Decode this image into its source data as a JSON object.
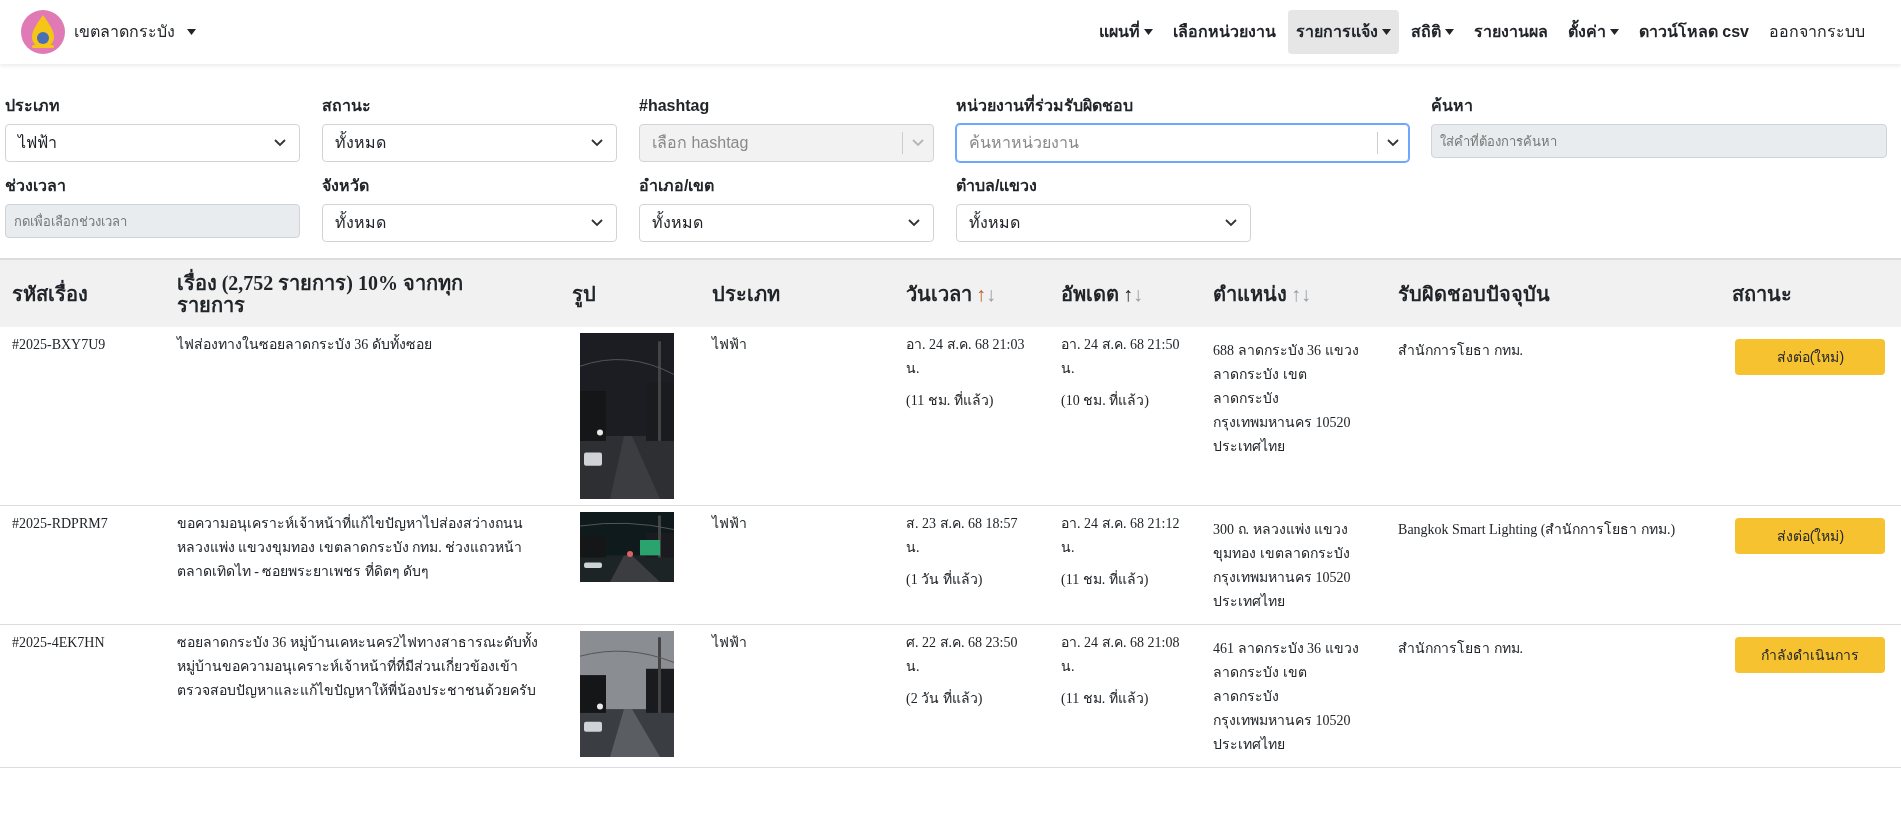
{
  "navbar": {
    "brand": "เขตลาดกระบัง",
    "items": [
      {
        "label": "แผนที่",
        "kind": "dropdown",
        "selected": false
      },
      {
        "label": "เลือกหน่วยงาน",
        "kind": "link",
        "selected": false
      },
      {
        "label": "รายการแจ้ง",
        "kind": "dropdown",
        "selected": true
      },
      {
        "label": "สถิติ",
        "kind": "dropdown",
        "selected": false
      },
      {
        "label": "รายงานผล",
        "kind": "link",
        "selected": false
      },
      {
        "label": "ตั้งค่า",
        "kind": "dropdown",
        "selected": false
      },
      {
        "label": "ดาวน์โหลด csv",
        "kind": "link",
        "selected": false
      },
      {
        "label": "ออกจากระบบ",
        "kind": "plain",
        "selected": false
      }
    ]
  },
  "filters": [
    [
      {
        "label": "ประเภท",
        "kind": "select",
        "value": "ไฟฟ้า",
        "focused": false
      },
      {
        "label": "สถานะ",
        "kind": "select",
        "value": "ทั้งหมด",
        "focused": false
      },
      {
        "label": "#hashtag",
        "kind": "combobox",
        "placeholder": "เลือก hashtag",
        "focused": false
      },
      {
        "label": "หน่วยงานที่ร่วมรับผิดชอบ",
        "kind": "combobox",
        "placeholder": "ค้นหาหน่วยงาน",
        "focused": true
      },
      {
        "label": "ค้นหา",
        "kind": "input",
        "placeholder": "ใส่คำที่ต้องการค้นหา",
        "focused": false
      }
    ],
    [
      {
        "label": "ช่วงเวลา",
        "kind": "input",
        "placeholder": "กดเพื่อเลือกช่วงเวลา",
        "focused": false
      },
      {
        "label": "จังหวัด",
        "kind": "select",
        "value": "ทั้งหมด",
        "focused": false
      },
      {
        "label": "อำเภอ/เขต",
        "kind": "select",
        "value": "ทั้งหมด",
        "focused": false
      },
      {
        "label": "ตำบล/แขวง",
        "kind": "select",
        "value": "ทั้งหมด",
        "focused": false
      }
    ]
  ],
  "table": {
    "columns": [
      {
        "label": "รหัสเรื่อง"
      },
      {
        "label": "เรื่อง (2,752 รายการ) 10% จากทุกรายการ"
      },
      {
        "label": "รูป"
      },
      {
        "label": "ประเภท"
      },
      {
        "label": "วันเวลา",
        "kind": "sorted",
        "up": "↑",
        "down": "↓"
      },
      {
        "label": "อัพเดต",
        "kind": "ascending",
        "up": "↑",
        "down": "↓"
      },
      {
        "label": "ตำแหน่ง",
        "kind": "sortable",
        "up": "↑",
        "down": "↓"
      },
      {
        "label": "รับผิดชอบปัจจุบัน"
      },
      {
        "label": "สถานะ"
      }
    ],
    "rows": [
      {
        "id": "#2025-BXY7U9",
        "title": "ไฟส่องทางในซอยลาดกระบัง 36 ดับทั้งซอย",
        "type": "ไฟฟ้า",
        "date": "อา. 24 ส.ค. 68 21:03 น.",
        "date_ago": "(11 ชม. ที่แล้ว)",
        "updated": "อา. 24 ส.ค. 68 21:50 น.",
        "updated_ago": "(10 ชม. ที่แล้ว)",
        "location": "688 ลาดกระบัง 36 แขวง ลาดกระบัง เขต ลาดกระบัง กรุงเทพมหานคร 10520 ประเทศไทย",
        "responsible": "สำนักการโยธา กทม.",
        "status": "ส่งต่อ(ใหม่)"
      },
      {
        "id": "#2025-RDPRM7",
        "title": "ขอความอนุเคราะห์เจ้าหน้าที่แก้ไขปัญหาไปส่องสว่างถนนหลวงแพ่ง แขวงขุมทอง เขตลาดกระบัง กทม. ช่วงแถวหน้าตลาดเทิดไท - ซอยพระยาเพชร ที่ดิตๆ ดับๆ",
        "type": "ไฟฟ้า",
        "date": "ส. 23 ส.ค. 68 18:57 น.",
        "date_ago": "(1 วัน ที่แล้ว)",
        "updated": "อา. 24 ส.ค. 68 21:12 น.",
        "updated_ago": "(11 ชม. ที่แล้ว)",
        "location": "300 ถ. หลวงแพ่ง แขวง ขุมทอง เขตลาดกระบัง กรุงเทพมหานคร 10520 ประเทศไทย",
        "responsible": "Bangkok Smart Lighting (สำนักการโยธา กทม.)",
        "status": "ส่งต่อ(ใหม่)"
      },
      {
        "id": "#2025-4EK7HN",
        "title": "ซอยลาดกระบัง 36 หมู่บ้านเคหะนคร2ไฟทางสาธารณะดับทั้งหมู่บ้านขอความอนุเคราะห์เจ้าหน้าที่ที่มีส่วนเกี่ยวข้องเข้าตรวจสอบปัญหาและแก้ไขปัญหาให้พี่น้องประชาชนด้วยครับ",
        "type": "ไฟฟ้า",
        "date": "ศ. 22 ส.ค. 68 23:50 น.",
        "date_ago": "(2 วัน ที่แล้ว)",
        "updated": "อา. 24 ส.ค. 68 21:08 น.",
        "updated_ago": "(11 ชม. ที่แล้ว)",
        "location": "461 ลาดกระบัง 36 แขวง ลาดกระบัง เขต ลาดกระบัง กรุงเทพมหานคร 10520 ประเทศไทย",
        "responsible": "สำนักการโยธา กทม.",
        "status": "กำลังดำเนินการ"
      }
    ]
  }
}
